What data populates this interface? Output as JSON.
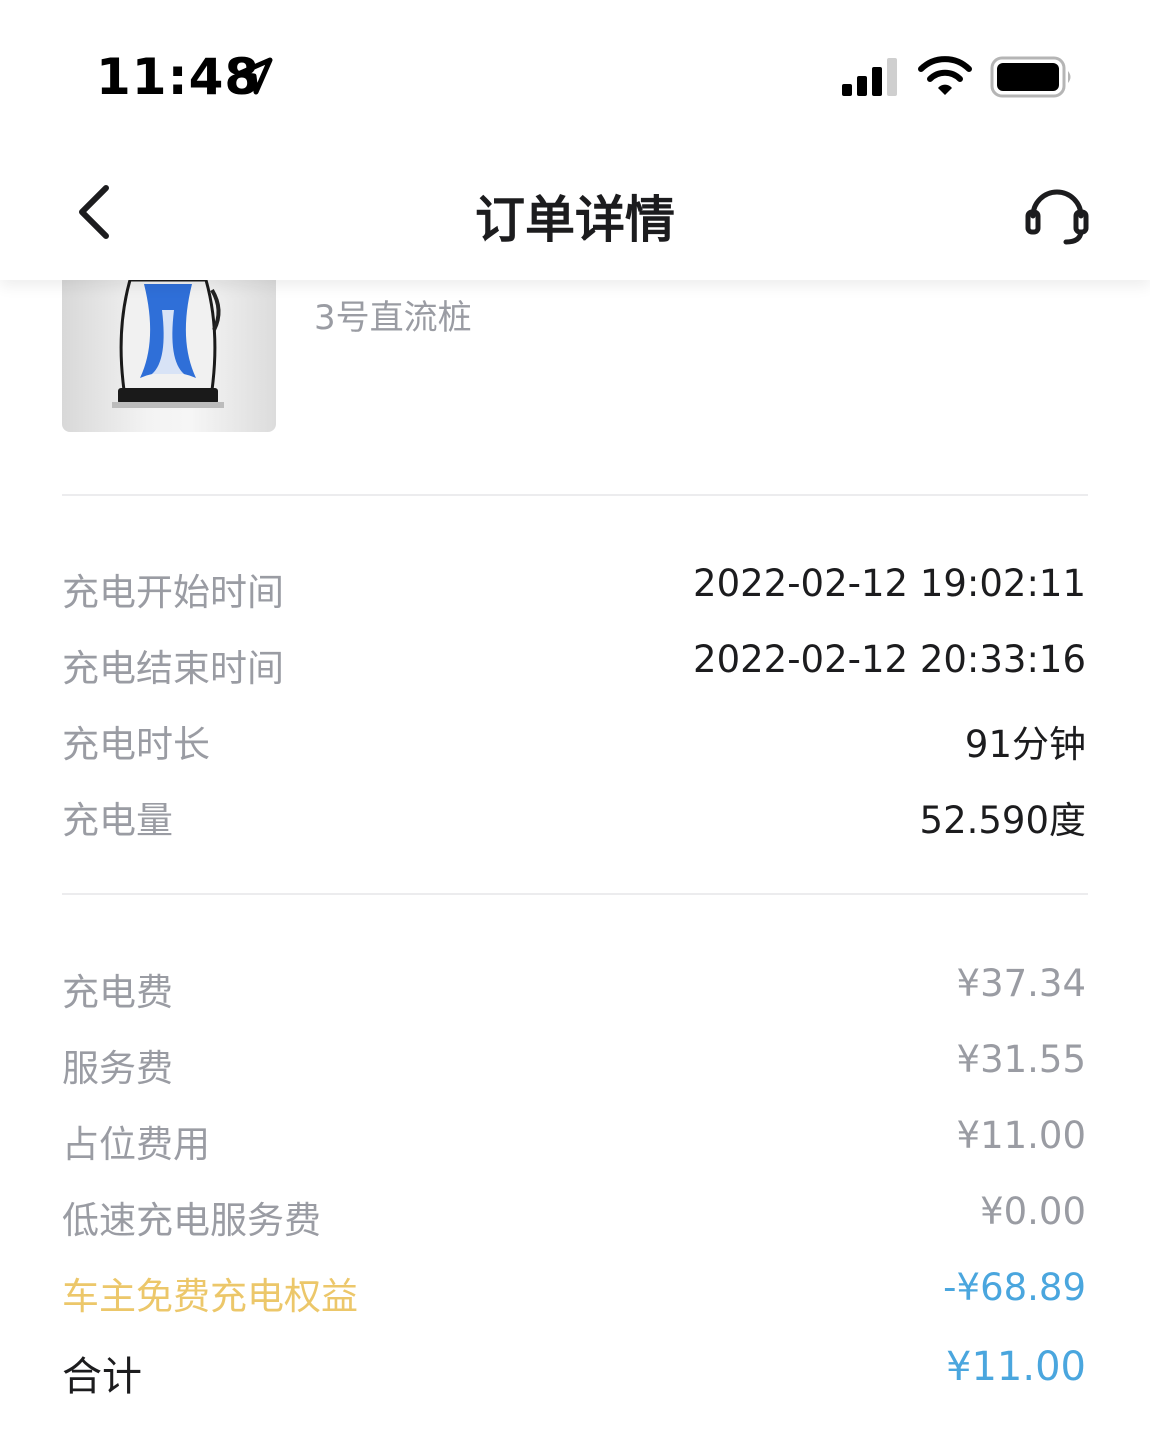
{
  "status_bar": {
    "time": "11:48"
  },
  "nav": {
    "title": "订单详情"
  },
  "charger": {
    "name": "3号直流桩"
  },
  "charging_info": [
    {
      "label": "充电开始时间",
      "value": "2022-02-12 19:02:11"
    },
    {
      "label": "充电结束时间",
      "value": "2022-02-12 20:33:16"
    },
    {
      "label": "充电时长",
      "value": "91分钟"
    },
    {
      "label": "充电量",
      "value": "52.590度"
    }
  ],
  "fees": [
    {
      "label": "充电费",
      "value": "¥37.34"
    },
    {
      "label": "服务费",
      "value": "¥31.55"
    },
    {
      "label": "占位费用",
      "value": "¥11.00"
    },
    {
      "label": "低速充电服务费",
      "value": "¥0.00"
    }
  ],
  "benefit": {
    "label": "车主免费充电权益",
    "value": "-¥68.89"
  },
  "total": {
    "label": "合计",
    "value": "¥11.00"
  },
  "colors": {
    "benefit_label": "#ecc76a",
    "accent_blue": "#4aa6de",
    "muted": "#9a9ca3"
  }
}
